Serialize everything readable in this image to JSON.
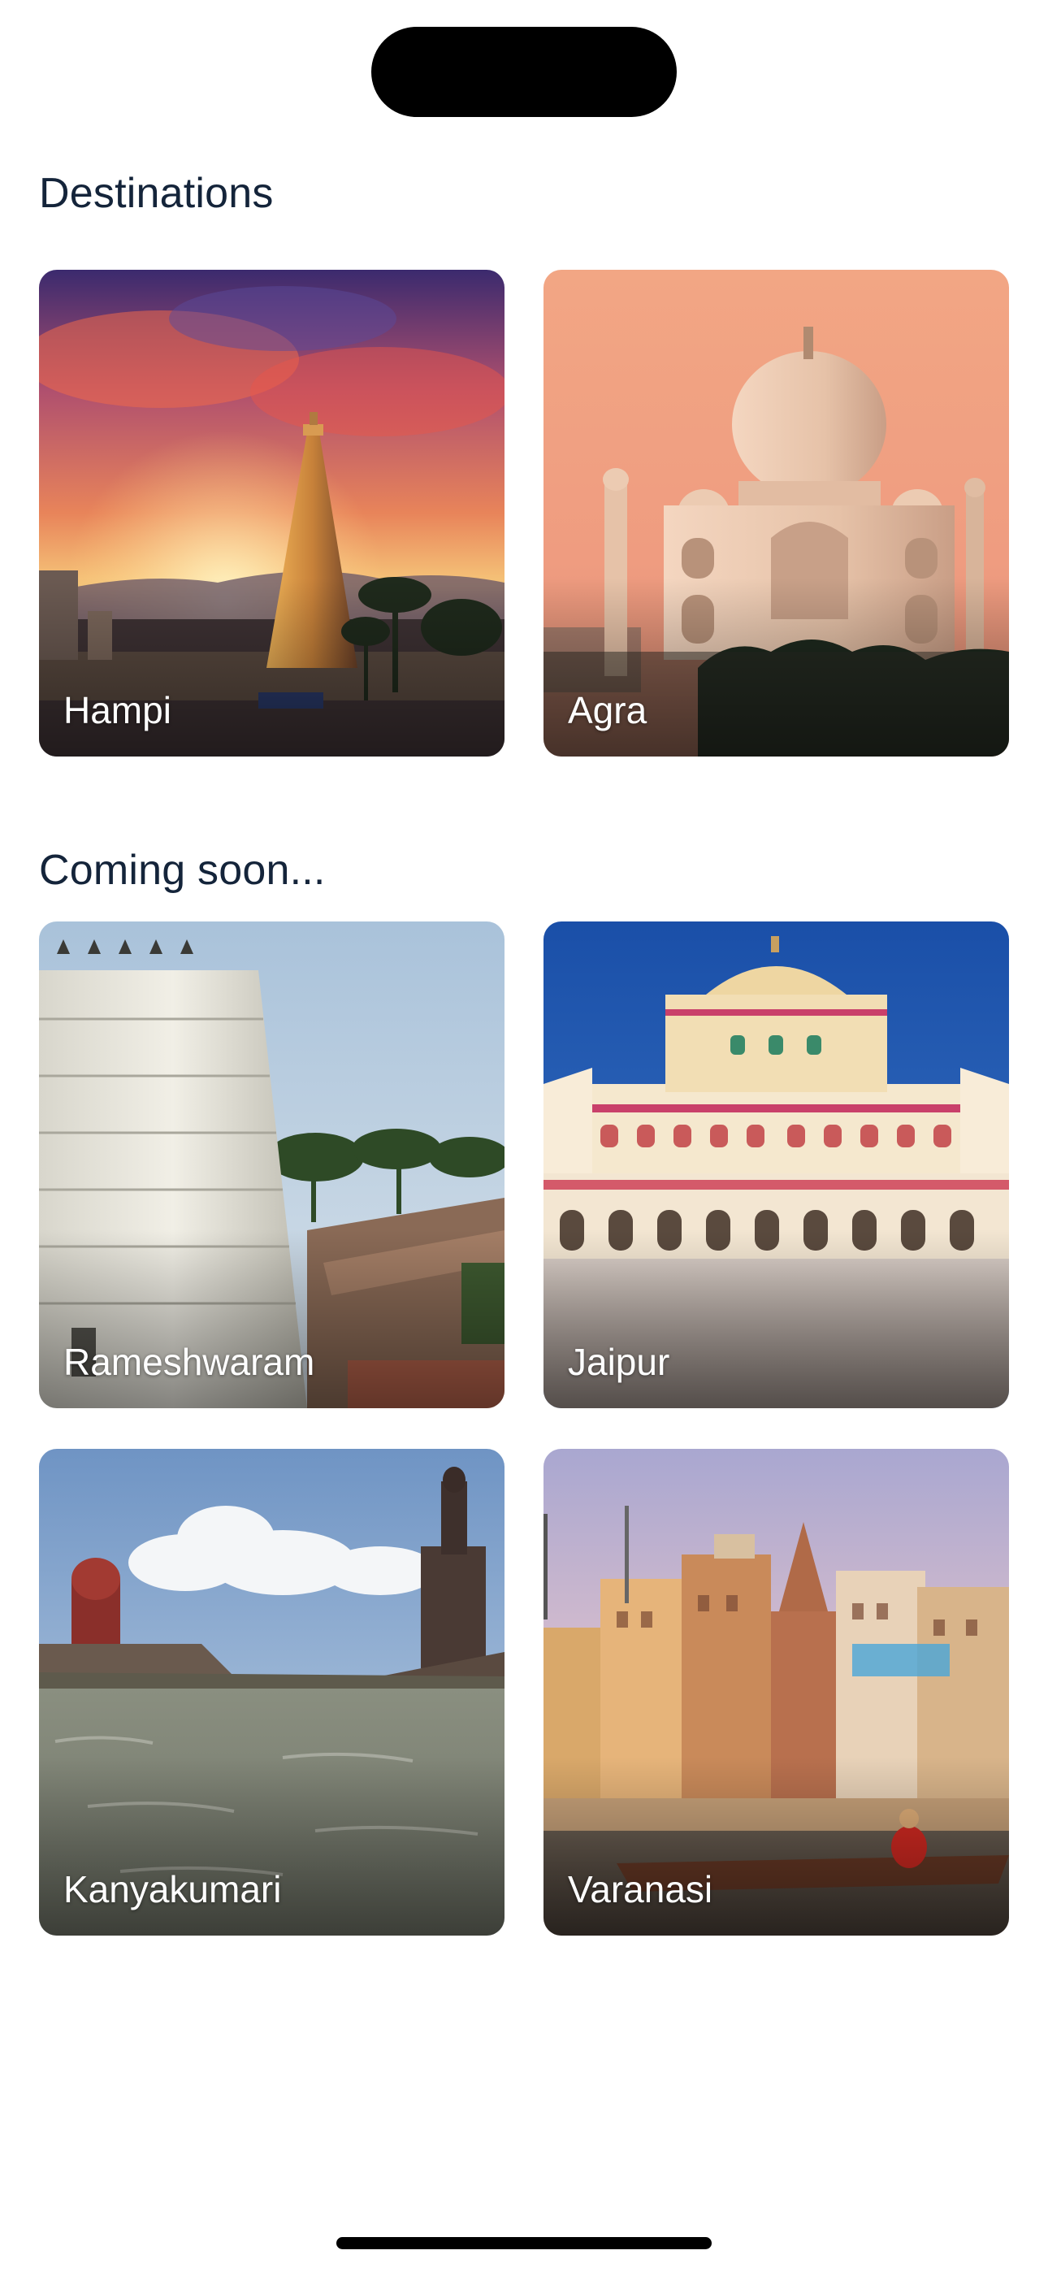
{
  "sections": [
    {
      "title": "Destinations",
      "cards": [
        {
          "name": "Hampi"
        },
        {
          "name": "Agra"
        }
      ]
    },
    {
      "title": "Coming soon...",
      "cards": [
        {
          "name": "Rameshwaram"
        },
        {
          "name": "Jaipur"
        },
        {
          "name": "Kanyakumari"
        },
        {
          "name": "Varanasi"
        }
      ]
    }
  ]
}
